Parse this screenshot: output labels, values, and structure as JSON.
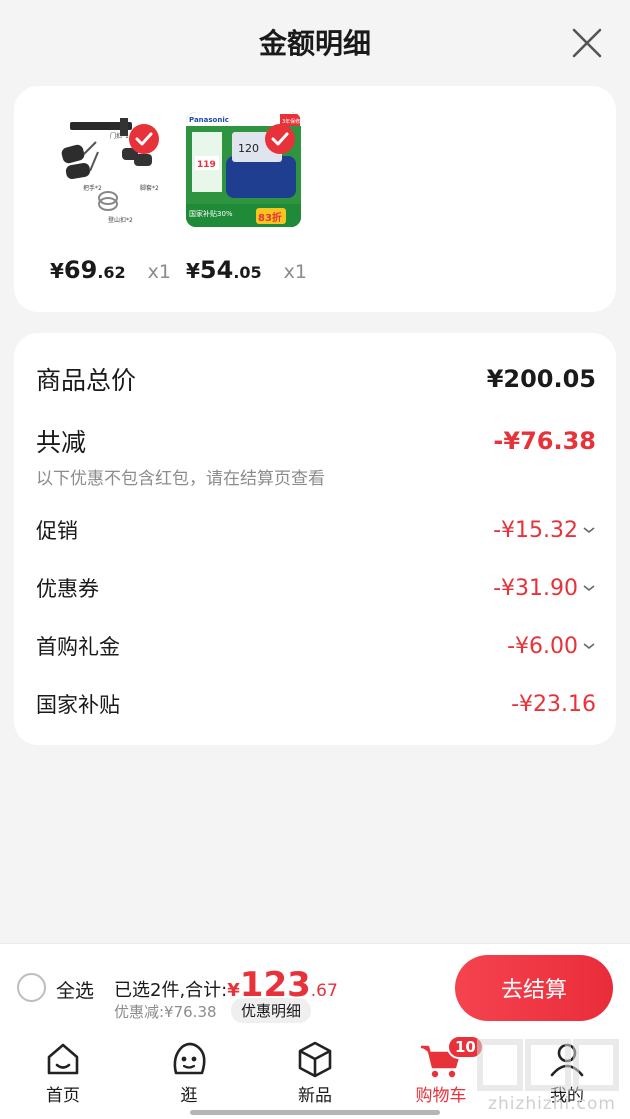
{
  "header": {
    "title": "金额明细"
  },
  "products": [
    {
      "price_currency": "¥",
      "price_int": "69",
      "price_dec": ".62",
      "qty": "x1",
      "image_labels": [
        "门扣*1",
        "把手*2",
        "脚套*2",
        "登山扣*2"
      ]
    },
    {
      "price_currency": "¥",
      "price_int": "54",
      "price_dec": ".05",
      "qty": "x1",
      "image_labels": [
        "Panasonic",
        "3年保修",
        "119",
        "国家补贴30%",
        "83折"
      ]
    }
  ],
  "summary": {
    "total_label": "商品总价",
    "total_value": "¥200.05",
    "reduce_label": "共减",
    "reduce_value": "-¥76.38",
    "note": "以下优惠不包含红包，请在结算页查看",
    "items": [
      {
        "label": "促销",
        "value": "-¥15.32"
      },
      {
        "label": "优惠券",
        "value": "-¥31.90"
      },
      {
        "label": "首购礼金",
        "value": "-¥6.00"
      },
      {
        "label": "国家补贴",
        "value": "-¥23.16"
      }
    ]
  },
  "checkout": {
    "select_all": "全选",
    "selected_text": "已选2件,合计:",
    "currency": "¥",
    "total_int": "123",
    "total_dec": ".67",
    "discount_text": "优惠减:¥76.38",
    "discount_detail": "优惠明细",
    "pay_label": "去结算"
  },
  "tabs": [
    {
      "label": "首页",
      "icon": "home-icon"
    },
    {
      "label": "逛",
      "icon": "face-icon"
    },
    {
      "label": "新品",
      "icon": "box-icon"
    },
    {
      "label": "购物车",
      "icon": "cart-icon",
      "badge": "10",
      "active": true
    },
    {
      "label": "我的",
      "icon": "user-icon"
    }
  ],
  "watermark": {
    "text": "zhizhizhi.com"
  },
  "colors": {
    "accent": "#e8323a",
    "muted": "#8c8c8c",
    "background": "#f4f4f4"
  }
}
